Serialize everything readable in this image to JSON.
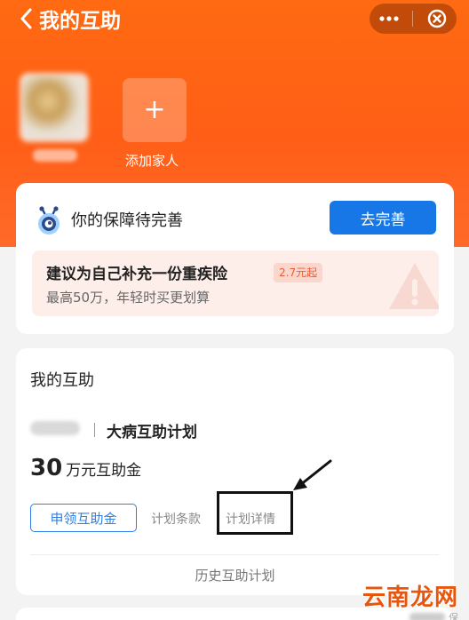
{
  "header": {
    "title": "我的互助",
    "back_icon": "chevron-left-icon",
    "more_icon": "more-icon",
    "close_icon": "close-circle-icon"
  },
  "family": {
    "add_label": "添加家人",
    "add_icon": "plus-icon"
  },
  "protection_card": {
    "title": "你的保障待完善",
    "action_label": "去完善",
    "suggestion_title": "建议为自己补充一份重疾险",
    "suggestion_badge": "2.7元起",
    "suggestion_sub": "最高50万，年轻时买更划算"
  },
  "mutual_aid": {
    "section_title": "我的互助",
    "plan_name": "大病互助计划",
    "amount": "30",
    "amount_unit": "万元互助金",
    "apply_label": "申领互助金",
    "terms_label": "计划条款",
    "details_label": "计划详情",
    "history_label": "历史互助计划"
  },
  "watermark": {
    "logo": "云南龙网",
    "sub": "保"
  },
  "colors": {
    "hero": "#ff6a12",
    "primary": "#1877e6",
    "accent": "#ef5a30"
  }
}
